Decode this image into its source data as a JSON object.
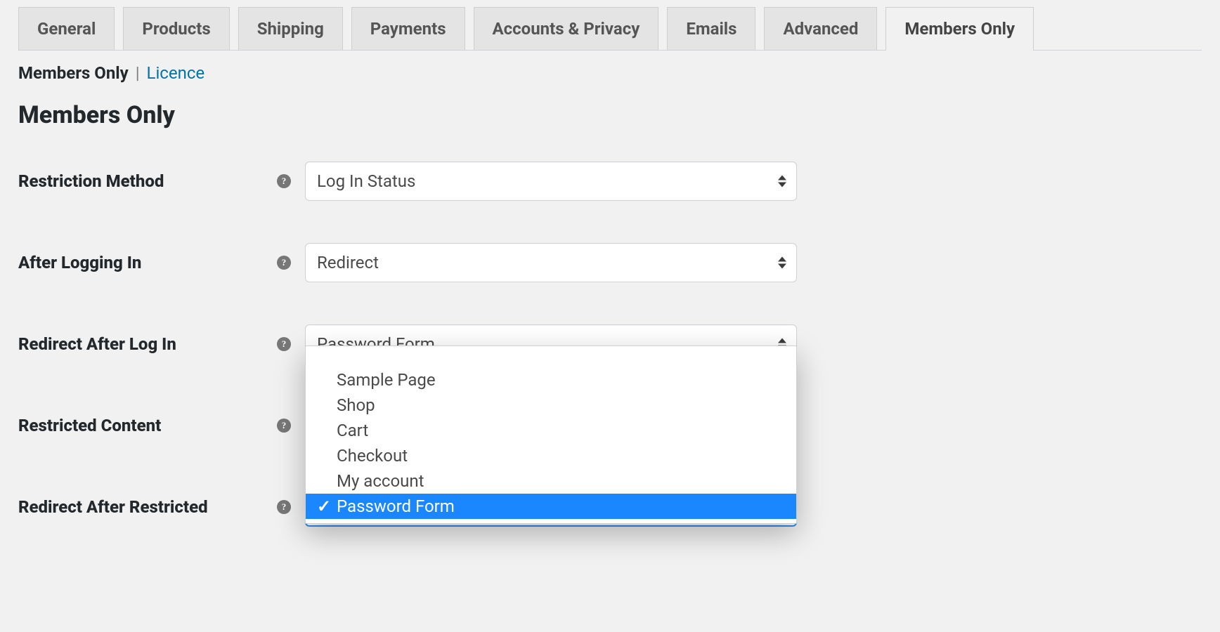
{
  "tabs": {
    "items": [
      {
        "label": "General",
        "active": false
      },
      {
        "label": "Products",
        "active": false
      },
      {
        "label": "Shipping",
        "active": false
      },
      {
        "label": "Payments",
        "active": false
      },
      {
        "label": "Accounts & Privacy",
        "active": false
      },
      {
        "label": "Emails",
        "active": false
      },
      {
        "label": "Advanced",
        "active": false
      },
      {
        "label": "Members Only",
        "active": true
      }
    ]
  },
  "subsections": {
    "current": "Members Only",
    "separator": "|",
    "other": "Licence"
  },
  "page": {
    "title": "Members Only"
  },
  "fields": {
    "restriction_method": {
      "label": "Restriction Method",
      "value": "Log In Status"
    },
    "after_logging_in": {
      "label": "After Logging In",
      "value": "Redirect"
    },
    "redirect_after_log_in": {
      "label": "Redirect After Log In",
      "value": "Password Form"
    },
    "restricted_content": {
      "label": "Restricted Content",
      "value": ""
    },
    "redirect_after_restricted": {
      "label": "Redirect After Restricted",
      "value": ""
    }
  },
  "dropdown": {
    "options": [
      {
        "label": "Sample Page",
        "selected": false
      },
      {
        "label": "Shop",
        "selected": false
      },
      {
        "label": "Cart",
        "selected": false
      },
      {
        "label": "Checkout",
        "selected": false
      },
      {
        "label": "My account",
        "selected": false
      },
      {
        "label": "Password Form",
        "selected": true
      }
    ]
  }
}
